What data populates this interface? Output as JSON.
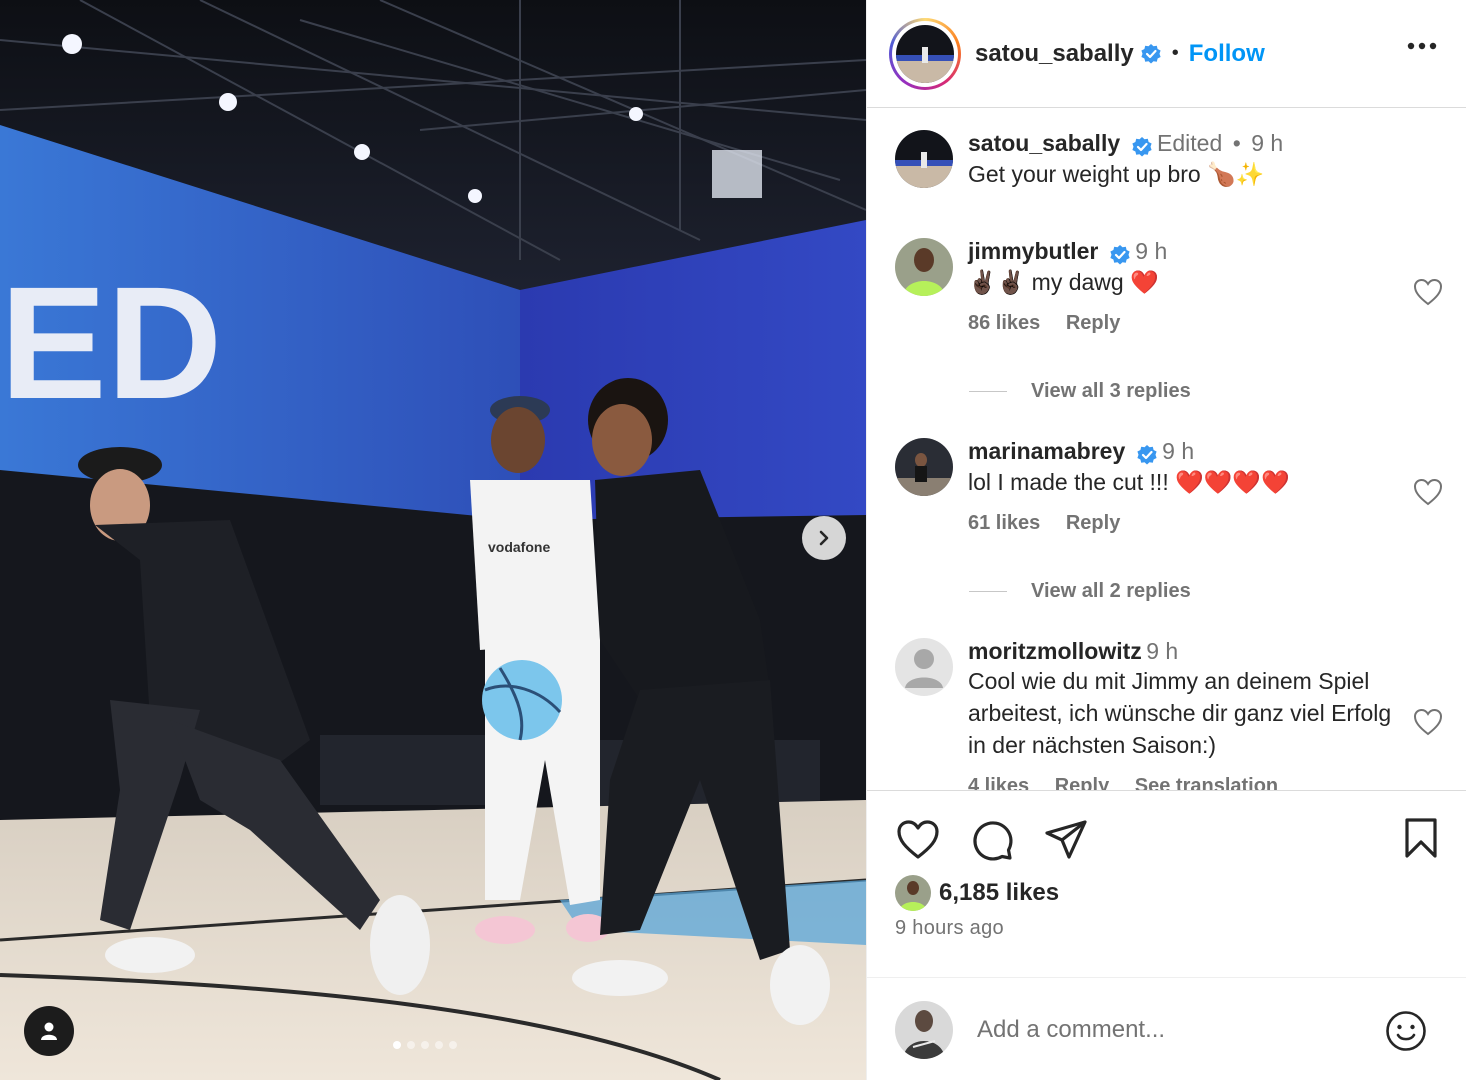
{
  "post": {
    "username": "satou_sabally",
    "follow_label": "Follow",
    "header_separator": "•",
    "carousel_dots": 5,
    "carousel_active_index": 0,
    "photo_banner_text": "ED",
    "jersey_text": "vodafone"
  },
  "caption": {
    "username": "satou_sabally",
    "edited": "Edited",
    "separator": "•",
    "time": "9 h",
    "text": "Get your weight up bro 🍗✨"
  },
  "comments": [
    {
      "username": "jimmybutler",
      "verified": true,
      "time": "9 h",
      "text": "✌🏿✌🏿 my dawg ❤️",
      "likes": "86 likes",
      "reply_label": "Reply",
      "view_replies": "View all 3 replies"
    },
    {
      "username": "marinamabrey",
      "verified": true,
      "time": "9 h",
      "text": "lol I made the cut !!! ❤️❤️❤️❤️",
      "likes": "61 likes",
      "reply_label": "Reply",
      "view_replies": "View all 2 replies"
    },
    {
      "username": "moritzmollowitz",
      "verified": false,
      "time": "9 h",
      "text": "Cool wie du mit Jimmy an deinem Spiel arbeitest, ich wünsche dir ganz viel Erfolg in der nächsten Saison:)",
      "likes": "4 likes",
      "reply_label": "Reply",
      "translate_label": "See translation"
    }
  ],
  "footer": {
    "likes": "6,185 likes",
    "time_ago": "9 hours ago",
    "comment_placeholder": "Add a comment..."
  },
  "icons": {
    "like": "heart-icon",
    "comment": "comment-icon",
    "share": "share-icon",
    "save": "bookmark-icon",
    "emoji": "smiley-icon",
    "more": "more-options-icon",
    "next": "chevron-right-icon",
    "tags": "user-tag-icon"
  },
  "colors": {
    "accent": "#0095f6",
    "verified": "#3897f0",
    "text": "#262626",
    "secondary": "#737373",
    "heart": "#e0245e"
  }
}
